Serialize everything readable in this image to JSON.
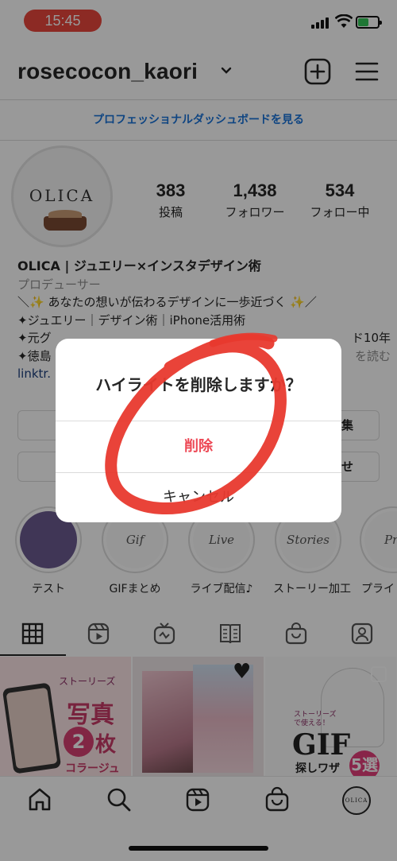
{
  "status_bar": {
    "time": "15:45",
    "signal_icon": "cellular-signal-icon",
    "wifi_icon": "wifi-icon",
    "battery_icon": "battery-charging-icon",
    "battery_color": "#35c759",
    "time_pill_color": "#e9463c"
  },
  "header": {
    "username": "rosecocon_kaori",
    "dropdown_icon": "chevron-down-icon",
    "new_post_icon": "plus-square-icon",
    "menu_icon": "hamburger-menu-icon"
  },
  "dashboard_link": "プロフェッショナルダッシュボードを見る",
  "profile": {
    "avatar_logo": "OLICA",
    "stats": [
      {
        "count": "383",
        "label": "投稿"
      },
      {
        "count": "1,438",
        "label": "フォロワー"
      },
      {
        "count": "534",
        "label": "フォロー中"
      }
    ],
    "name": "OLICA | ジュエリー×インスタデザイン術",
    "category": "プロデューサー",
    "bio_lines": [
      "＼✨ あなたの想いが伝わるデザインに一歩近づく ✨／",
      "✦ジュエリー｜デザイン術｜iPhone活用術",
      "✦元グ",
      "✦徳島"
    ],
    "bio_line3_tail": "ド10年",
    "more_label": "を読む",
    "link": "linktr.",
    "buttons": {
      "left_partial": "",
      "edit_partial": "集",
      "contact_partial": "せ"
    }
  },
  "highlights": [
    {
      "cover": "",
      "label": "テスト"
    },
    {
      "cover": "Gif",
      "label": "GIFまとめ"
    },
    {
      "cover": "Live",
      "label": "ライブ配信♪"
    },
    {
      "cover": "Stories",
      "label": "ストーリー加工"
    },
    {
      "cover": "Pri",
      "label": "プライ"
    }
  ],
  "tabs": {
    "icons": [
      "grid-icon",
      "reels-icon",
      "igtv-icon",
      "guides-icon",
      "shop-bag-icon",
      "tagged-person-icon"
    ],
    "active": 0
  },
  "grid_posts": [
    {
      "tag": "ストーリーズ",
      "line1": "写真",
      "circle": "2",
      "line2": "枚",
      "sub": "コラージュ"
    },
    {
      "decor": "♥"
    },
    {
      "tag": "ストーリーズで使える！",
      "title": "GIF",
      "sub": "探しワザ",
      "badge": "5選"
    }
  ],
  "bottom_nav": {
    "icons": [
      "home-icon",
      "search-icon",
      "reels-icon",
      "shop-bag-icon",
      "profile-avatar-icon"
    ],
    "avatar_text": "OLICA"
  },
  "dialog": {
    "title": "ハイライトを削除しますか？",
    "delete_label": "削除",
    "cancel_label": "キャンセル",
    "delete_color": "#ed4956"
  },
  "annotation": {
    "shape": "hand-drawn-circle",
    "color": "#e8392e"
  }
}
